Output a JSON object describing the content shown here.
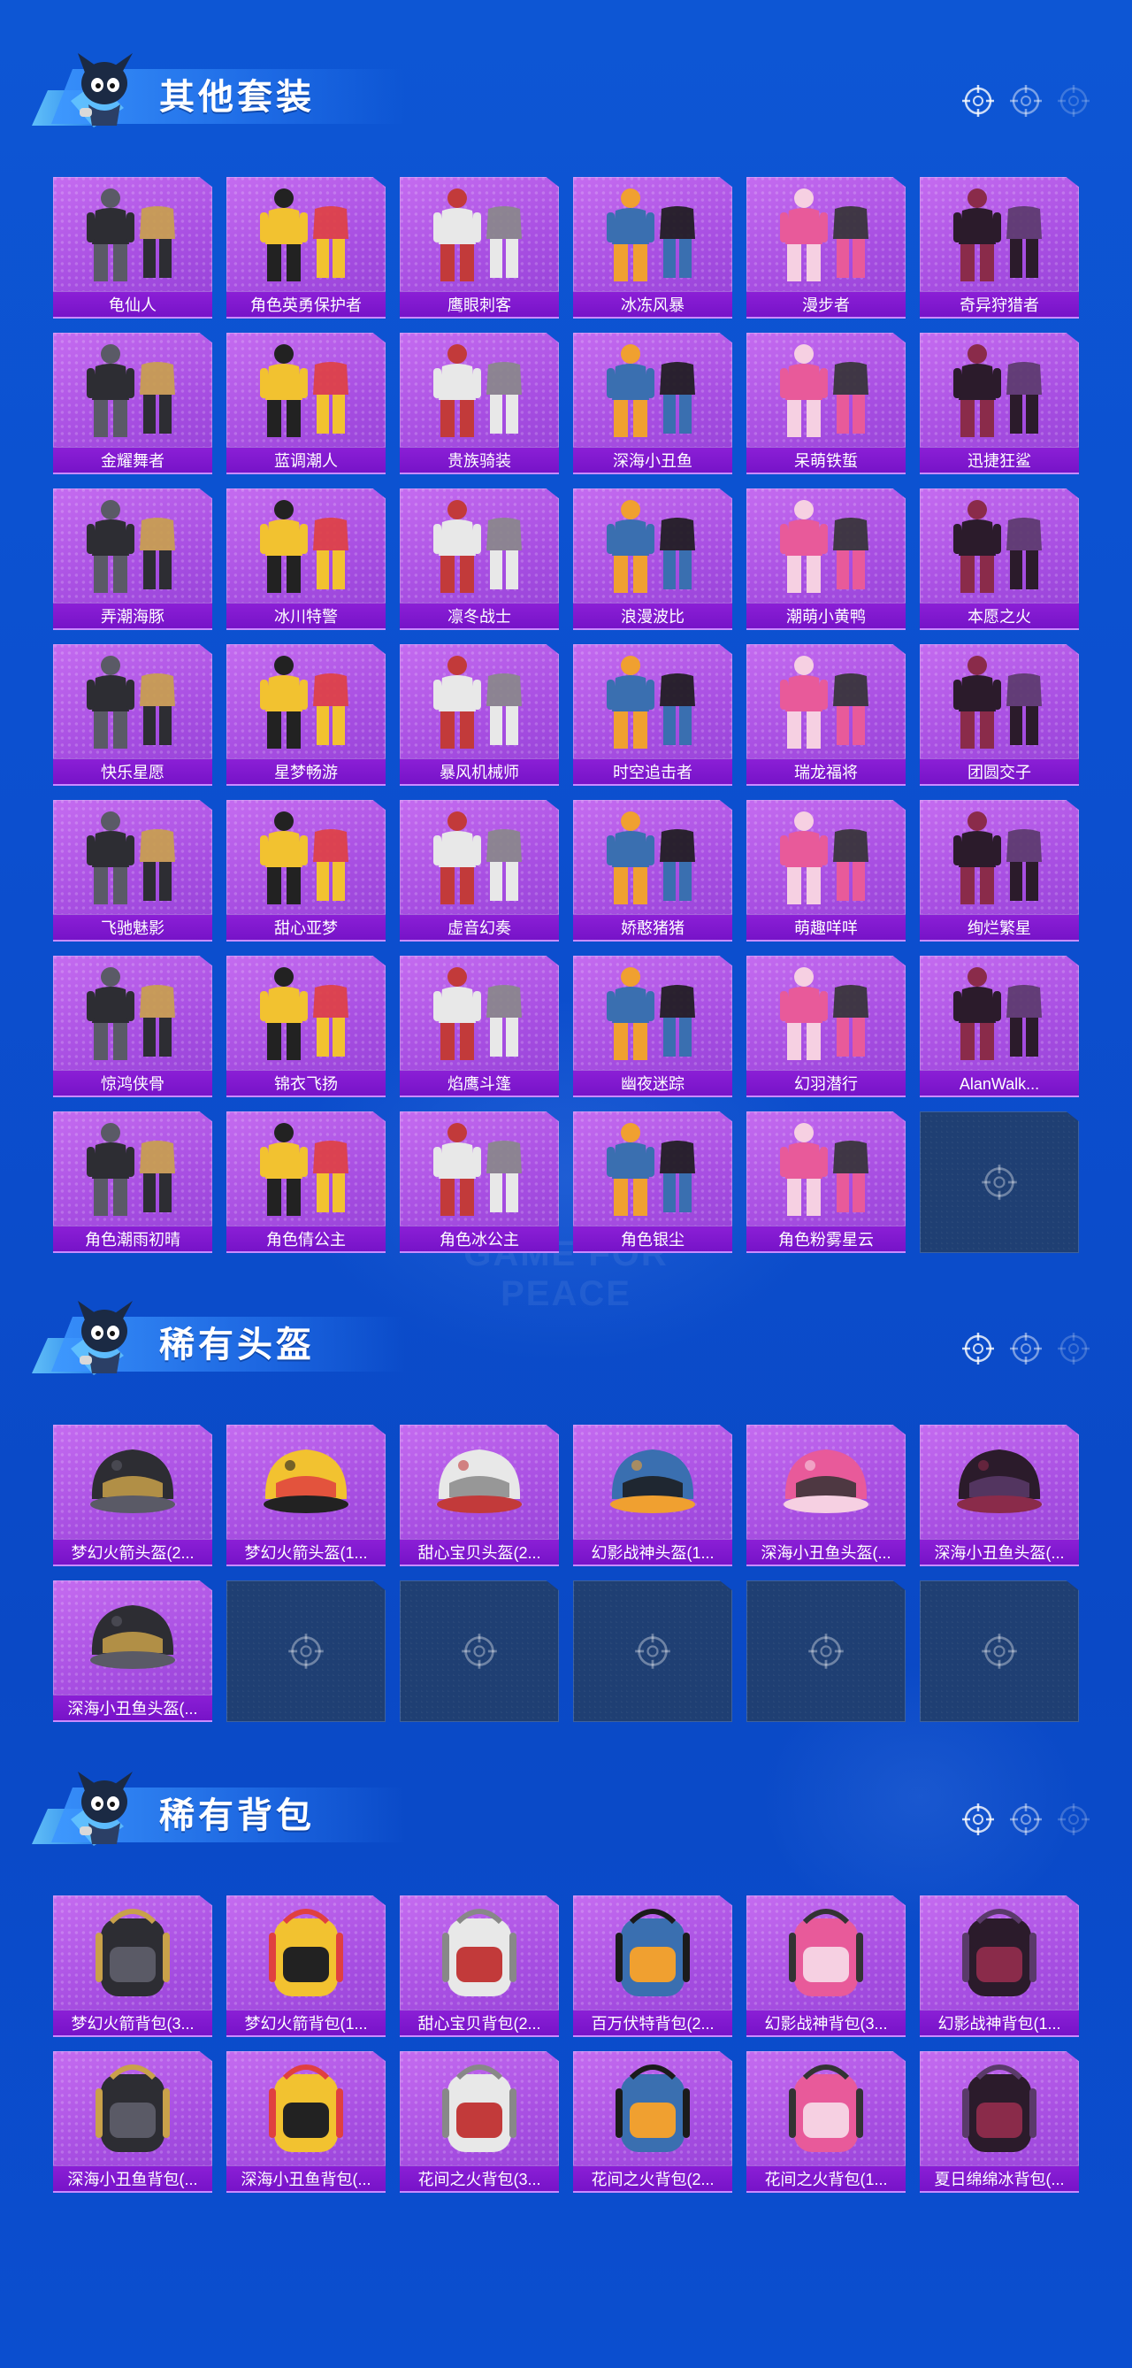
{
  "sections": [
    {
      "title": "其他套装",
      "items": [
        "龟仙人",
        "角色英勇保护者",
        "鹰眼刺客",
        "冰冻风暴",
        "漫步者",
        "奇异狩猎者",
        "金耀舞者",
        "蓝调潮人",
        "贵族骑装",
        "深海小丑鱼",
        "呆萌铁蜇",
        "迅捷狂鲨",
        "弄潮海豚",
        "冰川特警",
        "凛冬战士",
        "浪漫波比",
        "潮萌小黄鸭",
        "本愿之火",
        "快乐星愿",
        "星梦畅游",
        "暴风机械师",
        "时空追击者",
        "瑞龙福将",
        "团圆交子",
        "飞驰魅影",
        "甜心亚梦",
        "虚音幻奏",
        "娇憨猪猪",
        "萌趣咩咩",
        "绚烂繁星",
        "惊鸿侠骨",
        "锦衣飞扬",
        "焰鹰斗篷",
        "幽夜迷踪",
        "幻羽潜行",
        "AlanWalk...",
        "角色潮雨初晴",
        "角色倩公主",
        "角色冰公主",
        "角色银尘",
        "角色粉雾星云"
      ],
      "empty_slots": 1
    },
    {
      "title": "稀有头盔",
      "items": [
        "梦幻火箭头盔(2...",
        "梦幻火箭头盔(1...",
        "甜心宝贝头盔(2...",
        "幻影战神头盔(1...",
        "深海小丑鱼头盔(...",
        "深海小丑鱼头盔(...",
        "深海小丑鱼头盔(..."
      ],
      "empty_slots": 5
    },
    {
      "title": "稀有背包",
      "items": [
        "梦幻火箭背包(3...",
        "梦幻火箭背包(1...",
        "甜心宝贝背包(2...",
        "百万伏特背包(2...",
        "幻影战神背包(3...",
        "幻影战神背包(1...",
        "深海小丑鱼背包(...",
        "深海小丑鱼背包(...",
        "花间之火背包(3...",
        "花间之火背包(2...",
        "花间之火背包(1...",
        "夏日绵绵冰背包(..."
      ],
      "empty_slots": 0
    }
  ],
  "icons": {
    "section_deco": "crosshair-icon",
    "empty_slot": "crosshair-icon",
    "mascot": "mascot-icon"
  },
  "colors": {
    "card": "#a84fe2",
    "label_bar": "#7e17cc",
    "empty": "#1f3f73",
    "background": "#0c4fcf"
  },
  "watermark": "GAME FOR PEACE"
}
